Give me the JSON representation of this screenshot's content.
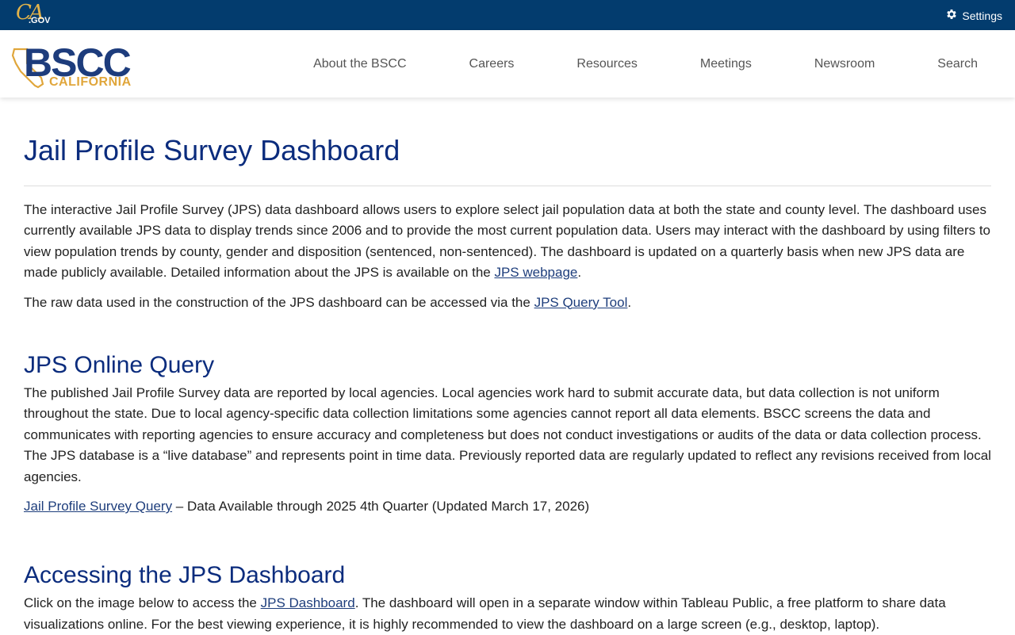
{
  "utility": {
    "logo_ca": "CA",
    "logo_gov": ".GOV",
    "settings_label": "Settings"
  },
  "header": {
    "brand_main": "BSCC",
    "brand_sub": "CALIFORNIA",
    "nav": [
      "About the BSCC",
      "Careers",
      "Resources",
      "Meetings",
      "Newsroom",
      "Search"
    ]
  },
  "page": {
    "title": "Jail Profile Survey Dashboard",
    "intro": {
      "p1_text": "The interactive Jail Profile Survey (JPS) data dashboard allows users to explore select jail population data at both the state and county level. The dashboard uses currently available JPS data to display trends since 2006 and to provide the most current population data. Users may interact with the dashboard by using filters to view population trends by county, gender and disposition (sentenced, non-sentenced). The dashboard is updated on a quarterly basis when new JPS data are made publicly available. Detailed information about the JPS is available on the ",
      "p1_link": "JPS webpage",
      "p1_end": ".",
      "p2_text": "The raw data used in the construction of the JPS dashboard can be accessed via the ",
      "p2_link": "JPS Query Tool",
      "p2_end": "."
    },
    "query_section": {
      "heading": "JPS Online Query",
      "body": "The published Jail Profile Survey data are reported by local agencies. Local agencies work hard to submit accurate data, but data collection is not uniform throughout the state. Due to local agency-specific data collection limitations some agencies cannot report all data elements. BSCC screens the data and communicates with reporting agencies to ensure accuracy and completeness but does not conduct investigations or audits of the data or data collection process. The JPS database is a “live database” and represents point in time data. Previously reported data are regularly updated to reflect any revisions received from local agencies.",
      "link": "Jail Profile Survey Query",
      "link_suffix": " – Data Available through 2025 4th Quarter (Updated March 17, 2026)"
    },
    "access_section": {
      "heading": "Accessing the JPS Dashboard",
      "text_start": "Click on the image below to access the ",
      "link": "JPS Dashboard",
      "text_end": ". The dashboard will open in a separate window within Tableau Public, a free platform to share data visualizations online. For the best viewing experience, it is highly recommended to view the dashboard on a large screen (e.g., desktop, laptop)."
    }
  },
  "colors": {
    "utility_bar": "#033c6e",
    "heading": "#0b2c7d",
    "brand_blue": "#1d3c7c",
    "brand_gold": "#e0a63b"
  }
}
